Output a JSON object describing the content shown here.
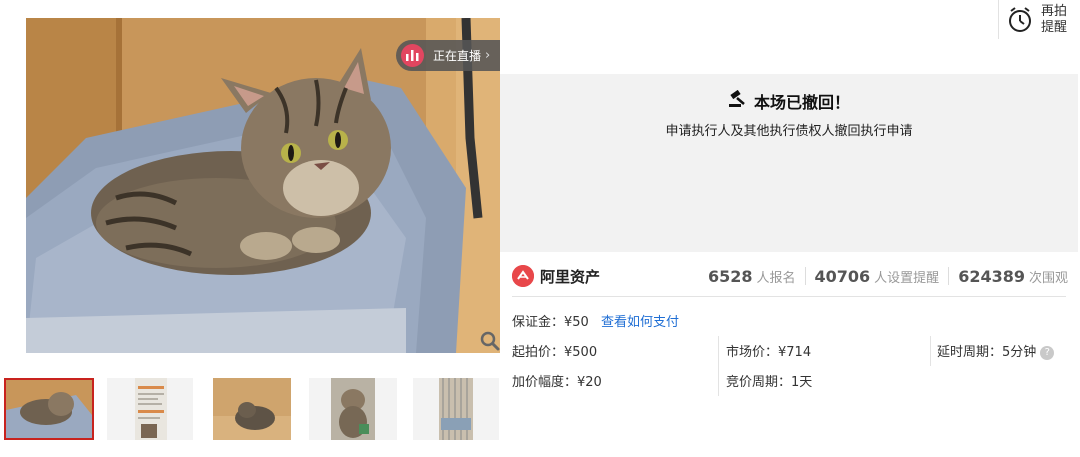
{
  "live": {
    "label": "正在直播",
    "arrow": "›"
  },
  "remind": {
    "line1": "再拍",
    "line2": "提醒"
  },
  "notice": {
    "title": "本场已撤回！",
    "subtitle": "申请执行人及其他执行债权人撤回执行申请"
  },
  "brand": {
    "name": "阿里资产"
  },
  "stats": [
    {
      "value": "6528",
      "label": "人报名"
    },
    {
      "value": "40706",
      "label": "人设置提醒"
    },
    {
      "value": "624389",
      "label": "次围观"
    }
  ],
  "deposit": {
    "label": "保证金：¥50",
    "link": "查看如何支付"
  },
  "details": {
    "start_price": "起拍价：¥500",
    "market_price": "市场价：¥714",
    "delay_period": "延时周期：5分钟",
    "increment": "加价幅度：¥20",
    "bid_period": "竞价周期：1天"
  },
  "thumbnails": [
    {
      "name": "cat-in-tray",
      "selected": true
    },
    {
      "name": "document-1",
      "selected": false
    },
    {
      "name": "cat-in-box",
      "selected": false
    },
    {
      "name": "cat-standing",
      "selected": false
    },
    {
      "name": "cage",
      "selected": false
    }
  ]
}
